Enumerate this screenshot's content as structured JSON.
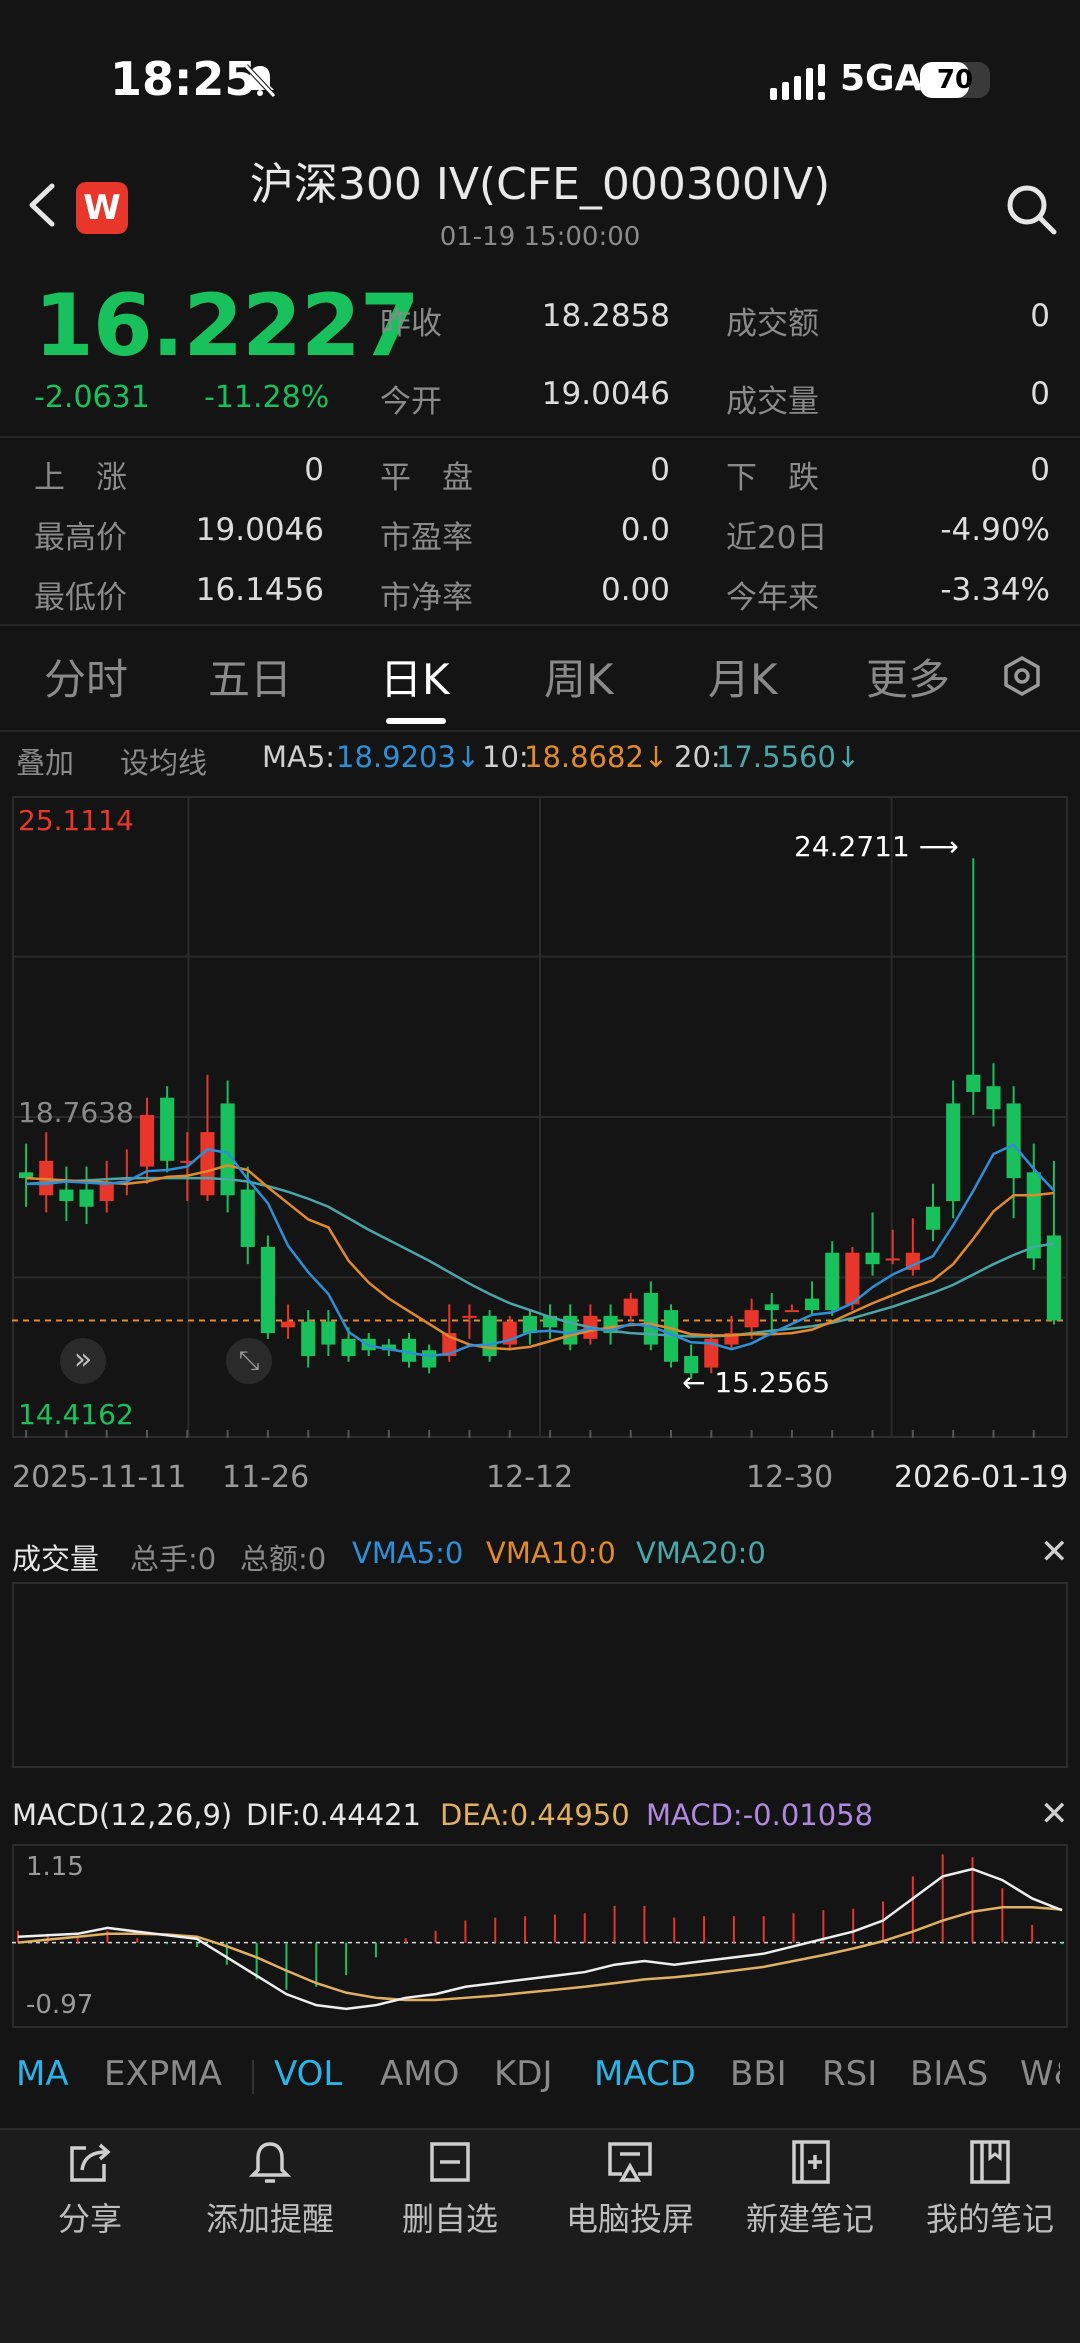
{
  "status": {
    "time": "18:25",
    "network": "5GA",
    "battery": "70",
    "battery_level": 0.7
  },
  "header": {
    "title": "沪深300 IV(CFE_000300IV)",
    "datetime": "01-19 15:00:00",
    "logo": "W"
  },
  "quote": {
    "price": "16.2227",
    "change": "-2.0631",
    "change_pct": "-11.28%",
    "prev_close_label": "昨收",
    "prev_close": "18.2858",
    "open_label": "今开",
    "open": "19.0046",
    "turnover_label": "成交额",
    "turnover": "0",
    "volume_label": "成交量",
    "volume": "0",
    "up_label": "上　涨",
    "up": "0",
    "flat_label": "平　盘",
    "flat": "0",
    "down_label": "下　跌",
    "down": "0",
    "high_label": "最高价",
    "high": "19.0046",
    "pe_label": "市盈率",
    "pe": "0.0",
    "d20_label": "近20日",
    "d20": "-4.90%",
    "low_label": "最低价",
    "low": "16.1456",
    "pb_label": "市净率",
    "pb": "0.00",
    "ytd_label": "今年来",
    "ytd": "-3.34%"
  },
  "tabs": [
    "分时",
    "五日",
    "日K",
    "周K",
    "月K",
    "更多"
  ],
  "ma_bar": {
    "overlay": "叠加",
    "set_ma": "设均线",
    "ma5_label": "MA5:",
    "ma5": "18.9203↓",
    "ma10_label": "10:",
    "ma10": "18.8682↓",
    "ma20_label": "20:",
    "ma20": "17.5560↓"
  },
  "chart_labels": {
    "top": "25.1114",
    "bottom": "14.4162",
    "mid": "18.7638",
    "max_note": "24.2711 ⟶",
    "min_note": "← 15.2565"
  },
  "dates": [
    "2025-11-11",
    "11-26",
    "12-12",
    "12-30",
    "2026-01-19"
  ],
  "volume": {
    "title": "成交量",
    "total_hands": "总手:0",
    "total_amount": "总额:0",
    "vma5": "VMA5:0",
    "vma10": "VMA10:0",
    "vma20": "VMA20:0"
  },
  "macd": {
    "title": "MACD(12,26,9)",
    "dif": "DIF:0.44421",
    "dea": "DEA:0.44950",
    "macd": "MACD:-0.01058",
    "top": "1.15",
    "bottom": "-0.97"
  },
  "indicators": [
    "MA",
    "EXPMA",
    "VOL",
    "AMO",
    "KDJ",
    "MACD",
    "BBI",
    "RSI",
    "BIAS",
    "W&"
  ],
  "bottom_actions": [
    "分享",
    "添加提醒",
    "删自选",
    "电脑投屏",
    "新建笔记",
    "我的笔记"
  ],
  "colors": {
    "up": "#e8362a",
    "down": "#19c15c",
    "ma5": "#2e8fd6",
    "ma10": "#e08a2c",
    "ma20": "#4aa6a8",
    "accent": "#2bb3e6"
  },
  "chart_data": {
    "type": "candlestick",
    "ylim": [
      14.4162,
      25.1114
    ],
    "candles": [
      [
        18.8,
        18.7,
        19.3,
        18.2
      ],
      [
        18.4,
        19.0,
        19.5,
        18.1
      ],
      [
        18.5,
        18.3,
        18.9,
        17.95
      ],
      [
        18.5,
        18.2,
        18.9,
        17.9
      ],
      [
        18.3,
        18.6,
        19.0,
        18.1
      ],
      [
        18.7,
        18.7,
        19.2,
        18.4
      ],
      [
        18.9,
        19.8,
        20.1,
        18.6
      ],
      [
        20.1,
        19.0,
        20.3,
        18.8
      ],
      [
        19.0,
        19.0,
        19.5,
        18.3
      ],
      [
        18.4,
        19.5,
        20.5,
        18.3
      ],
      [
        20.0,
        18.4,
        20.4,
        18.1
      ],
      [
        18.5,
        17.5,
        18.9,
        17.2
      ],
      [
        17.5,
        16.0,
        17.7,
        15.9
      ],
      [
        16.1,
        16.2,
        16.5,
        15.9
      ],
      [
        16.2,
        15.6,
        16.4,
        15.4
      ],
      [
        16.2,
        15.8,
        16.4,
        15.6
      ],
      [
        15.9,
        15.6,
        16.1,
        15.5
      ],
      [
        15.9,
        15.7,
        16.0,
        15.6
      ],
      [
        15.8,
        15.7,
        15.9,
        15.6
      ],
      [
        15.9,
        15.5,
        16.0,
        15.4
      ],
      [
        15.7,
        15.4,
        15.8,
        15.3
      ],
      [
        15.6,
        16.0,
        16.5,
        15.5
      ],
      [
        16.3,
        16.3,
        16.5,
        15.9
      ],
      [
        16.3,
        15.6,
        16.4,
        15.5
      ],
      [
        15.8,
        16.2,
        16.3,
        15.7
      ],
      [
        16.3,
        16.0,
        16.4,
        15.8
      ],
      [
        16.3,
        16.1,
        16.5,
        15.9
      ],
      [
        16.3,
        15.8,
        16.5,
        15.7
      ],
      [
        15.9,
        16.3,
        16.5,
        15.8
      ],
      [
        16.3,
        16.0,
        16.5,
        15.8
      ],
      [
        16.3,
        16.6,
        16.7,
        16.2
      ],
      [
        16.7,
        15.8,
        16.9,
        15.7
      ],
      [
        16.4,
        15.5,
        16.5,
        15.4
      ],
      [
        15.6,
        15.3,
        15.8,
        15.2
      ],
      [
        15.4,
        15.9,
        16.0,
        15.3
      ],
      [
        15.8,
        16.0,
        16.3,
        15.7
      ],
      [
        16.1,
        16.4,
        16.6,
        15.9
      ],
      [
        16.5,
        16.4,
        16.7,
        16.0
      ],
      [
        16.4,
        16.4,
        16.5,
        16.4
      ],
      [
        16.6,
        16.4,
        16.9,
        16.3
      ],
      [
        17.4,
        16.4,
        17.6,
        16.3
      ],
      [
        16.5,
        17.4,
        17.5,
        16.4
      ],
      [
        17.4,
        17.2,
        18.1,
        17.0
      ],
      [
        17.3,
        17.3,
        17.8,
        17.2
      ],
      [
        17.1,
        17.4,
        18.0,
        17.0
      ],
      [
        18.2,
        17.8,
        18.6,
        17.6
      ],
      [
        20.0,
        18.3,
        20.4,
        18.0
      ],
      [
        20.5,
        20.2,
        24.27,
        19.8
      ],
      [
        20.3,
        19.9,
        20.7,
        19.6
      ],
      [
        20.0,
        18.7,
        20.3,
        18.0
      ],
      [
        18.8,
        17.3,
        19.3,
        17.1
      ],
      [
        17.7,
        16.22,
        19.0,
        16.15
      ]
    ],
    "ma5": [
      18.6,
      18.6,
      18.64,
      18.62,
      18.6,
      18.64,
      18.82,
      18.84,
      18.9,
      19.2,
      19.14,
      18.68,
      18.26,
      17.52,
      17.06,
      16.68,
      16.02,
      15.78,
      15.72,
      15.66,
      15.6,
      15.64,
      15.78,
      15.8,
      15.88,
      16.02,
      16.04,
      16.0,
      16.08,
      16.04,
      16.16,
      16.12,
      15.98,
      15.84,
      15.82,
      15.72,
      15.82,
      16.0,
      16.16,
      16.32,
      16.36,
      16.52,
      16.8,
      17.02,
      17.18,
      17.34,
      17.88,
      18.48,
      19.12,
      19.28,
      18.86,
      18.48
    ],
    "ma10": [
      18.7,
      18.68,
      18.66,
      18.64,
      18.62,
      18.6,
      18.64,
      18.72,
      18.74,
      18.82,
      18.92,
      18.84,
      18.54,
      18.26,
      17.98,
      17.84,
      17.26,
      16.88,
      16.6,
      16.38,
      16.16,
      15.94,
      15.8,
      15.74,
      15.72,
      15.76,
      15.86,
      15.96,
      16.04,
      16.1,
      16.14,
      16.16,
      16.08,
      15.98,
      15.96,
      15.96,
      15.98,
      15.98,
      16.0,
      16.06,
      16.2,
      16.36,
      16.52,
      16.66,
      16.8,
      16.92,
      17.2,
      17.64,
      18.12,
      18.4,
      18.4,
      18.44
    ],
    "ma20": [
      18.6,
      18.62,
      18.64,
      18.66,
      18.68,
      18.7,
      18.7,
      18.7,
      18.7,
      18.7,
      18.68,
      18.64,
      18.56,
      18.46,
      18.34,
      18.2,
      18.0,
      17.8,
      17.62,
      17.44,
      17.26,
      17.06,
      16.86,
      16.68,
      16.52,
      16.4,
      16.28,
      16.18,
      16.1,
      16.04,
      16.0,
      15.98,
      15.96,
      15.94,
      15.94,
      15.96,
      16.0,
      16.04,
      16.08,
      16.12,
      16.18,
      16.26,
      16.36,
      16.46,
      16.58,
      16.7,
      16.84,
      17.02,
      17.2,
      17.36,
      17.5,
      17.56
    ],
    "macd_dif": [
      0.08,
      0.1,
      0.12,
      0.2,
      0.15,
      0.1,
      0.05,
      -0.2,
      -0.45,
      -0.7,
      -0.85,
      -0.9,
      -0.85,
      -0.75,
      -0.7,
      -0.6,
      -0.55,
      -0.5,
      -0.45,
      -0.4,
      -0.3,
      -0.25,
      -0.3,
      -0.25,
      -0.2,
      -0.15,
      -0.05,
      0.05,
      0.15,
      0.3,
      0.6,
      0.9,
      1.0,
      0.85,
      0.6,
      0.44
    ],
    "macd_dea": [
      0.0,
      0.04,
      0.08,
      0.12,
      0.12,
      0.11,
      0.08,
      -0.05,
      -0.2,
      -0.38,
      -0.55,
      -0.68,
      -0.75,
      -0.78,
      -0.78,
      -0.75,
      -0.72,
      -0.68,
      -0.64,
      -0.6,
      -0.55,
      -0.5,
      -0.47,
      -0.43,
      -0.38,
      -0.33,
      -0.25,
      -0.17,
      -0.08,
      0.02,
      0.15,
      0.3,
      0.42,
      0.48,
      0.48,
      0.45
    ]
  }
}
